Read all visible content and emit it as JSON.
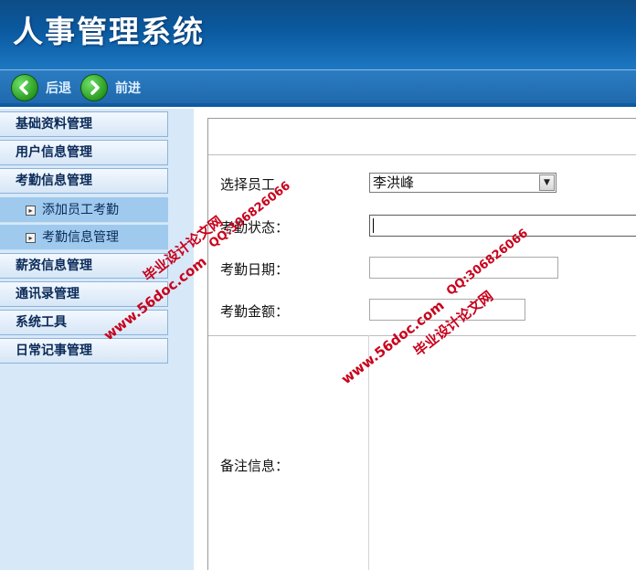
{
  "app": {
    "title": "人事管理系统"
  },
  "nav": {
    "back_label": "后退",
    "forward_label": "前进"
  },
  "sidebar": {
    "items": [
      {
        "label": "基础资料管理"
      },
      {
        "label": "用户信息管理"
      },
      {
        "label": "考勤信息管理"
      },
      {
        "label": "薪资信息管理"
      },
      {
        "label": "通讯录管理"
      },
      {
        "label": "系统工具"
      },
      {
        "label": "日常记事管理"
      }
    ],
    "subitems": [
      {
        "label": "添加员工考勤"
      },
      {
        "label": "考勤信息管理"
      }
    ]
  },
  "form": {
    "employee_label": "选择员工",
    "employee_value": "李洪峰",
    "status_label": "考勤状态：",
    "status_value": "",
    "date_label": "考勤日期：",
    "date_value": "",
    "amount_label": "考勤金额：",
    "amount_value": "",
    "notes_label": "备注信息：",
    "notes_value": ""
  },
  "watermarks": {
    "line1": "毕业设计论文网",
    "line2": "www.56doc.com",
    "line3": "QQ:306826066"
  },
  "colors": {
    "header": "#0d4c86",
    "sidebar": "#d7e8f8",
    "watermark": "#c9001c"
  }
}
